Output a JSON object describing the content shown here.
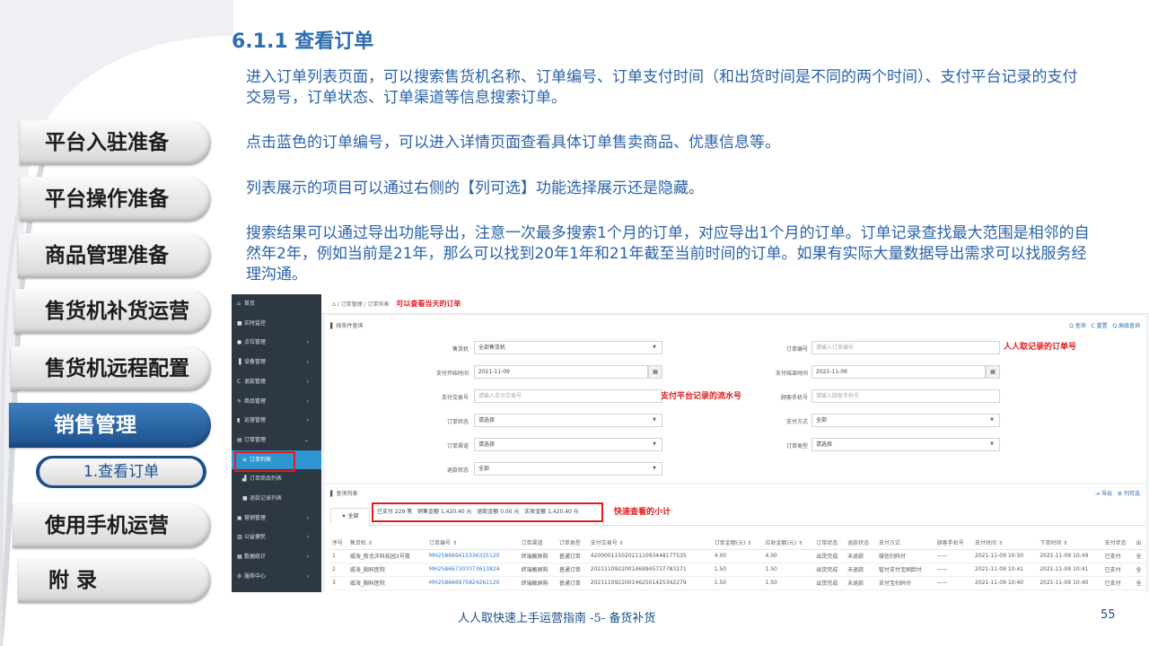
{
  "heading": "6.1.1 查看订单",
  "paragraphs": [
    "进入订单列表页面，可以搜索售货机名称、订单编号、订单支付时间（和出货时间是不同的两个时间）、支付平台记录的支付交易号，订单状态、订单渠道等信息搜索订单。",
    "点击蓝色的订单编号，可以进入详情页面查看具体订单售卖商品、优惠信息等。",
    "列表展示的项目可以通过右侧的【列可选】功能选择展示还是隐藏。",
    "搜索结果可以通过导出功能导出，注意一次最多搜索1个月的订单，对应导出1个月的订单。订单记录查找最大范围是相邻的自然年2年，例如当前是21年，那么可以找到20年1年和21年截至当前时间的订单。如果有实际大量数据导出需求可以找服务经理沟通。"
  ],
  "nav": {
    "items": [
      "平台入驻准备",
      "平台操作准备",
      "商品管理准备",
      "售货机补货运营",
      "售货机远程配置",
      "销售管理",
      "使用手机运营",
      "附 录"
    ],
    "sub_item": "1.查看订单"
  },
  "colors": {
    "accent": "#1b4f8c",
    "heading": "#2e6db0",
    "highlight": "#e31b1b",
    "link": "#2e7bc9"
  },
  "screenshot": {
    "sidebar": [
      {
        "icon": "⌂",
        "label": "首页",
        "arrow": ""
      },
      {
        "icon": "■",
        "label": "实时监控",
        "arrow": ""
      },
      {
        "icon": "●",
        "label": "点位管理",
        "arrow": "›"
      },
      {
        "icon": "▐",
        "label": "设备管理",
        "arrow": "›"
      },
      {
        "icon": "C",
        "label": "退款管理",
        "arrow": "›"
      },
      {
        "icon": "✎",
        "label": "商品管理",
        "arrow": "›"
      },
      {
        "icon": "▮",
        "label": "运营管理",
        "arrow": "›"
      },
      {
        "icon": "▤",
        "label": "订单管理",
        "arrow": "⌄"
      },
      {
        "icon": "≡",
        "label": "订单列表",
        "arrow": ""
      },
      {
        "icon": "▟",
        "label": "订单商品列表",
        "arrow": ""
      },
      {
        "icon": "■",
        "label": "退款记录列表",
        "arrow": ""
      },
      {
        "icon": "▣",
        "label": "营销管理",
        "arrow": "›"
      },
      {
        "icon": "▥",
        "label": "公益便民",
        "arrow": "›"
      },
      {
        "icon": "▦",
        "label": "数据统计",
        "arrow": "›"
      },
      {
        "icon": "⚙",
        "label": "服务中心",
        "arrow": "›"
      }
    ],
    "breadcrumb": "⌂ / 订单管理 / 订单列表",
    "breadcrumb_note": "可以查看当天的订单",
    "search_title": "▌ 按条件查询",
    "search_actions": [
      "Q 查询",
      "C 重置",
      "Q 高级查询"
    ],
    "fields": {
      "vending_label": "售货机",
      "vending_value": "全部售货机",
      "order_no_label": "订单编号",
      "order_no_ph": "请输入订单编号",
      "pay_start_label": "支付开始时间",
      "pay_start_value": "2021-11-09",
      "pay_end_label": "支付结束时间",
      "pay_end_value": "2021-11-09",
      "trade_no_label": "支付交易号",
      "trade_no_ph": "请输入支付交易号",
      "phone_label": "顾客手机号",
      "phone_ph": "请输入顾客手机号",
      "status_label": "订单状态",
      "status_value": "请选择",
      "pay_method_label": "支付方式",
      "pay_method_value": "全部",
      "channel_label": "订单渠道",
      "channel_value": "请选择",
      "type_label": "订单类型",
      "type_value": "请选择",
      "refund_label": "退款状态",
      "refund_value": "全部"
    },
    "notes": {
      "order_no": "人人取记录的订单号",
      "trade_no": "支付平台记录的流水号",
      "summary": "快速查看的小计"
    },
    "list_title": "▌ 查询列表",
    "list_actions": [
      "⇥ 导出",
      "⚙ 列可选"
    ],
    "tab_all": "✦ 全部",
    "summary": [
      "已支付 229 笔",
      "销售金额 1,420.40 元",
      "退款金额 0.00 元",
      "实收金额 1,420.40 元"
    ],
    "table_headers": [
      "序号",
      "售货机 ⇕",
      "订单编号 ⇕",
      "订单渠道",
      "订单类型",
      "支付交易号 ⇕",
      "订单金额(元) ⇕",
      "应收金额(元) ⇕",
      "订单状态",
      "退款状态",
      "支付方式",
      "顾客手机号",
      "支付时间 ⇕",
      "下单时间 ⇕",
      "支付状态",
      "出"
    ],
    "rows": [
      [
        "1",
        "威海_新北洋科技园3号楼",
        "MH258669415336325120",
        "终端触屏购",
        "普通订单",
        "4200001150202111093448177535",
        "4.00",
        "4.00",
        "出货完成",
        "未退款",
        "微信扫码付",
        "——",
        "2021-11-09 10:50",
        "2021-11-09 10:49",
        "已支付",
        "全"
      ],
      [
        "2",
        "威海_胸科医院",
        "MH258667307073613824",
        "终端触屏购",
        "普通订单",
        "2021110922001469945737783271",
        "1.50",
        "1.50",
        "出货完成",
        "未退款",
        "智付支付宝刷脸付",
        "——",
        "2021-11-09 10:41",
        "2021-11-09 10:41",
        "已支付",
        "全"
      ],
      [
        "3",
        "威海_胸科医院",
        "MH258666975824261120",
        "终端触屏购",
        "普通订单",
        "2021110922001462501425342279",
        "1.50",
        "1.50",
        "出货完成",
        "未退款",
        "支付宝扫码付",
        "——",
        "2021-11-09 10:40",
        "2021-11-09 10:40",
        "已支付",
        "全"
      ]
    ]
  },
  "footer": "人人取快速上手运营指南 -5- 备货补货",
  "page_number": "55"
}
